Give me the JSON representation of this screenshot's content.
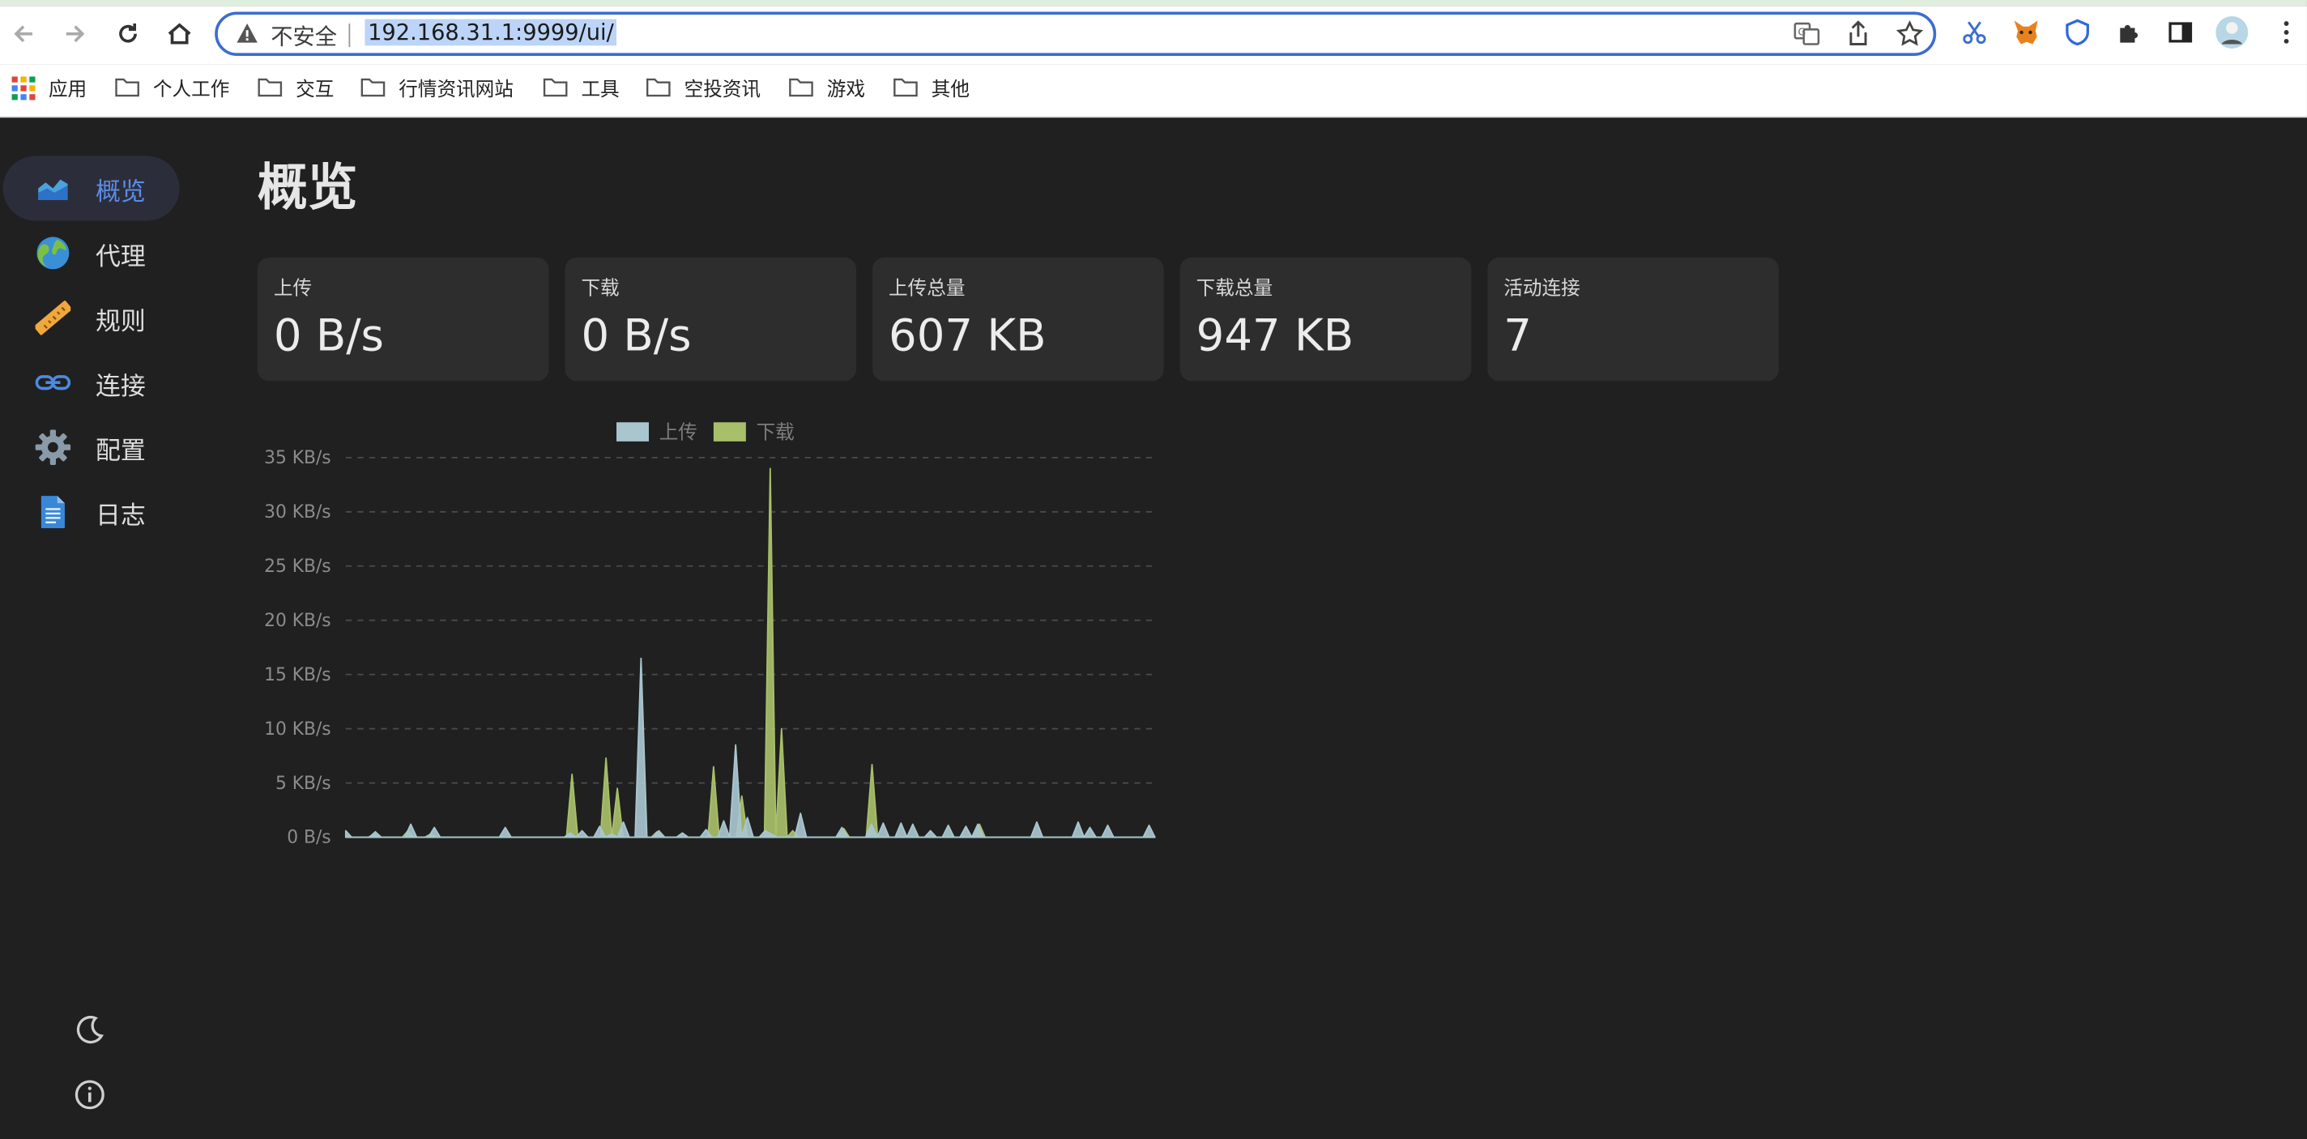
{
  "browser": {
    "security_label": "不安全",
    "url": "192.168.31.1:9999/ui/",
    "bookmarks": [
      "应用",
      "个人工作",
      "交互",
      "行情资讯网站",
      "工具",
      "空投资讯",
      "游戏",
      "其他"
    ]
  },
  "sidebar": {
    "items": [
      {
        "label": "概览",
        "icon": "chart-area-icon"
      },
      {
        "label": "代理",
        "icon": "globe-icon"
      },
      {
        "label": "规则",
        "icon": "ruler-icon"
      },
      {
        "label": "连接",
        "icon": "link-icon"
      },
      {
        "label": "配置",
        "icon": "gear-icon"
      },
      {
        "label": "日志",
        "icon": "document-icon"
      }
    ],
    "active_index": 0,
    "bottom_icons": [
      "moon-icon",
      "info-icon"
    ]
  },
  "page": {
    "title": "概览",
    "stats": [
      {
        "label": "上传",
        "value": "0 B/s"
      },
      {
        "label": "下载",
        "value": "0 B/s"
      },
      {
        "label": "上传总量",
        "value": "607 KB"
      },
      {
        "label": "下载总量",
        "value": "947 KB"
      },
      {
        "label": "活动连接",
        "value": "7"
      }
    ]
  },
  "colors": {
    "accent": "#5b8ce8",
    "upload": "#a9c6cf",
    "download": "#a8bf6a",
    "background": "#202020",
    "card": "#2d2d2d"
  },
  "chart_data": {
    "type": "area",
    "title": "",
    "xlabel": "",
    "ylabel": "",
    "y_unit": "KB/s",
    "ylim": [
      0,
      35
    ],
    "yticks": [
      "0 B/s",
      "5 KB/s",
      "10 KB/s",
      "15 KB/s",
      "20 KB/s",
      "25 KB/s",
      "30 KB/s",
      "35 KB/s"
    ],
    "grid": true,
    "legend": "top-center",
    "series": [
      {
        "name": "上传",
        "color": "#a9c6cf",
        "values": [
          0.6,
          0,
          0,
          0,
          0,
          0.5,
          0,
          0,
          0,
          0,
          0,
          1.2,
          0,
          0,
          0,
          0.9,
          0,
          0,
          0,
          0,
          0,
          0,
          0,
          0,
          0,
          0,
          0,
          0.9,
          0,
          0,
          0,
          0,
          0,
          0,
          0,
          0,
          0,
          0,
          0.4,
          0,
          0.6,
          0,
          0,
          1,
          0,
          0.3,
          0,
          1.4,
          0,
          0,
          16.5,
          0,
          0,
          0.6,
          0,
          0,
          0,
          0.4,
          0,
          0,
          0,
          0.7,
          0,
          0,
          1.5,
          0,
          8.5,
          0,
          1.8,
          0,
          0,
          0.6,
          0.3,
          0,
          0,
          0,
          0,
          2.2,
          0,
          0,
          0,
          0,
          0,
          0,
          0.9,
          0,
          0,
          0,
          0,
          1.2,
          0,
          1.3,
          0,
          0,
          1.3,
          0,
          1.2,
          0,
          0,
          0.6,
          0,
          0,
          1.1,
          0,
          0,
          1,
          0,
          1.2,
          0,
          0,
          0,
          0,
          0,
          0,
          0,
          0,
          0,
          1.4,
          0,
          0,
          0,
          0,
          0,
          0,
          1.4,
          0,
          0.9,
          0,
          0,
          1.1,
          0,
          0,
          0,
          0,
          0,
          0,
          1.1,
          0
        ]
      },
      {
        "name": "下载",
        "color": "#a8bf6a",
        "values": [
          0,
          0,
          0,
          0,
          0,
          0.3,
          0,
          0,
          0,
          0,
          0,
          0.6,
          0,
          0,
          0,
          0.3,
          0,
          0,
          0,
          0,
          0,
          0,
          0,
          0,
          0,
          0,
          0,
          0,
          0,
          0,
          0,
          0,
          0,
          0,
          0,
          0,
          0,
          0,
          0,
          0,
          5.8,
          0,
          0,
          0,
          0,
          0,
          7.3,
          0,
          4.5,
          0,
          0,
          0,
          0,
          0,
          0,
          0.5,
          0,
          0,
          0,
          0,
          0,
          0,
          0,
          0,
          0,
          6.5,
          0,
          0,
          0,
          0,
          3.8,
          0,
          0,
          0,
          0,
          34,
          0,
          10,
          0,
          0.6,
          0,
          0,
          0,
          0,
          0,
          0,
          0,
          0,
          0.8,
          0,
          0,
          0,
          0,
          6.7,
          0,
          0,
          0,
          0,
          0,
          0,
          0,
          0,
          0,
          0,
          0,
          0,
          0,
          0,
          0,
          0,
          0,
          0,
          1.2,
          0,
          0,
          0,
          0,
          0,
          0,
          0,
          0,
          0,
          0,
          0,
          0,
          0,
          0,
          0,
          0,
          0,
          0,
          0,
          0,
          0,
          0,
          0,
          0,
          0,
          0,
          0,
          0,
          0,
          0,
          0
        ]
      }
    ]
  }
}
